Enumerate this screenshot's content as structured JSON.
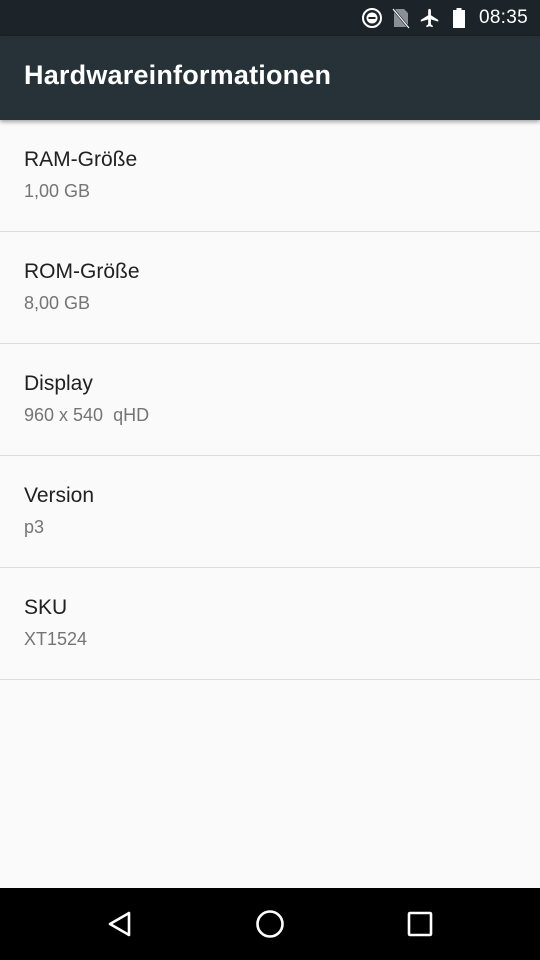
{
  "status_bar": {
    "time": "08:35",
    "icons": [
      "do-not-disturb-icon",
      "no-sim-icon",
      "airplane-mode-icon",
      "battery-icon"
    ]
  },
  "app_bar": {
    "title": "Hardwareinformationen"
  },
  "items": [
    {
      "title": "RAM-Größe",
      "value": "1,00 GB"
    },
    {
      "title": "ROM-Größe",
      "value": "8,00 GB"
    },
    {
      "title": "Display",
      "value": "960 x 540  qHD"
    },
    {
      "title": "Version",
      "value": "p3"
    },
    {
      "title": "SKU",
      "value": "XT1524"
    }
  ],
  "nav_bar": {
    "buttons": [
      "back-icon",
      "home-icon",
      "recents-icon"
    ]
  },
  "colors": {
    "status_bar_bg": "#1c2429",
    "app_bar_bg": "#263238",
    "page_bg": "#fafafa",
    "primary_text": "#212121",
    "secondary_text": "#757575",
    "divider": "#dcdcdc",
    "nav_bar_bg": "#000000"
  }
}
